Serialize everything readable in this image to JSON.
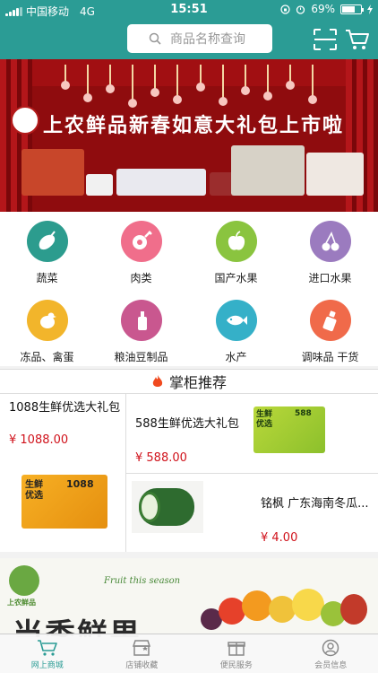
{
  "status": {
    "carrier": "中国移动",
    "network": "4G",
    "time": "15:51",
    "battery": "69%",
    "battery_level": 0.69
  },
  "header": {
    "search_placeholder": "商品名称查询",
    "scan_icon": "scan-icon",
    "cart_icon": "cart-icon",
    "bg_color": "#2b9c95"
  },
  "banner": {
    "title": "上农鲜品新春如意大礼包上市啦"
  },
  "categories": [
    {
      "label": "蔬菜",
      "icon": "eggplant-icon",
      "color": "#2c9c8e"
    },
    {
      "label": "肉类",
      "icon": "meat-icon",
      "color": "#f06e8b"
    },
    {
      "label": "国产水果",
      "icon": "apple-icon",
      "color": "#8ac43f"
    },
    {
      "label": "进口水果",
      "icon": "cherry-icon",
      "color": "#9b7bbf"
    },
    {
      "label": "冻品、禽蛋",
      "icon": "chicken-icon",
      "color": "#f2b52b"
    },
    {
      "label": "粮油豆制品",
      "icon": "oil-bottle-icon",
      "color": "#c9578f"
    },
    {
      "label": "水产",
      "icon": "fish-icon",
      "color": "#35b0c8"
    },
    {
      "label": "调味品  干货",
      "icon": "seasoning-icon",
      "color": "#f06a4a"
    }
  ],
  "recommend": {
    "title": "掌柜推荐",
    "items": [
      {
        "name": "1088生鲜优选大礼包",
        "price": "¥ 1088.00",
        "card_text": "1088",
        "card_label": "生鲜优选"
      },
      {
        "name": "588生鲜优选大礼包",
        "price": "¥ 588.00",
        "card_text": "588",
        "card_label": "生鲜优选"
      },
      {
        "name": "铭枫 广东海南冬瓜...",
        "price": "¥ 4.00"
      }
    ]
  },
  "bottom_banner": {
    "brand": "上农鲜品",
    "script_text": "Fruit this season",
    "headline": "当季鲜果"
  },
  "tabs": [
    {
      "label": "网上商城",
      "icon": "cart-icon",
      "active": true
    },
    {
      "label": "店铺收藏",
      "icon": "store-icon",
      "active": false
    },
    {
      "label": "便民服务",
      "icon": "gift-icon",
      "active": false
    },
    {
      "label": "会员信息",
      "icon": "user-icon",
      "active": false
    }
  ]
}
